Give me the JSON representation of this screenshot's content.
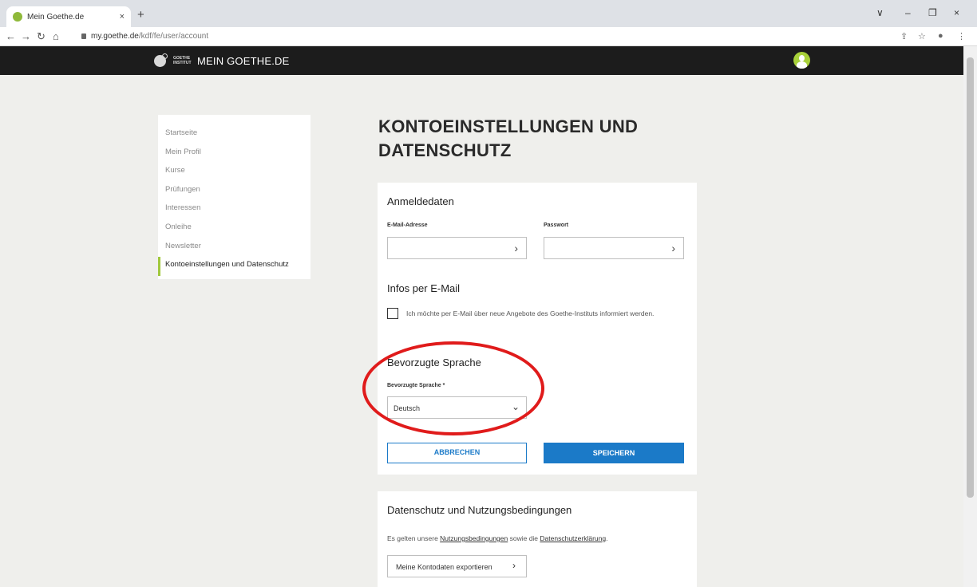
{
  "browser": {
    "tab_title": "Mein Goethe.de",
    "tab_close": "×",
    "new_tab": "+",
    "url_domain": "my.goethe.de",
    "url_path": "/kdf/fe/user/account",
    "window_controls": [
      "∨",
      "–",
      "❐",
      "×"
    ]
  },
  "site": {
    "logo_small": "GOETHE INSTITUT",
    "brand": "MEIN GOETHE.DE"
  },
  "sidebar": {
    "items": [
      {
        "label": "Startseite"
      },
      {
        "label": "Mein Profil"
      },
      {
        "label": "Kurse"
      },
      {
        "label": "Prüfungen"
      },
      {
        "label": "Interessen"
      },
      {
        "label": "Onleihe"
      },
      {
        "label": "Newsletter"
      },
      {
        "label": "Kontoeinstellungen und Datenschutz"
      }
    ],
    "active_index": 7
  },
  "main": {
    "title": "KONTOEINSTELLUNGEN UND DATENSCHUTZ",
    "login": {
      "heading": "Anmeldedaten",
      "email_label": "E-Mail-Adresse",
      "password_label": "Passwort"
    },
    "email_info": {
      "heading": "Infos per E-Mail",
      "checkbox_text": "Ich möchte per E-Mail über neue Angebote des Goethe-Instituts informiert werden."
    },
    "language": {
      "heading": "Bevorzugte Sprache",
      "label": "Bevorzugte Sprache *",
      "selected": "Deutsch"
    },
    "buttons": {
      "cancel": "ABBRECHEN",
      "save": "SPEICHERN"
    },
    "privacy": {
      "heading": "Datenschutz und Nutzungsbedingungen",
      "text_prefix": "Es gelten unsere ",
      "link_terms": "Nutzungsbedingungen",
      "text_middle": " sowie die ",
      "link_privacy": "Datenschutzerklärung",
      "text_suffix": ".",
      "export_button": "Meine Kontodaten exportieren"
    }
  },
  "colors": {
    "accent_blue": "#1b7ac8",
    "active_green": "#a0c83c",
    "annotation_red": "#e01b1b",
    "header_black": "#1c1c1c"
  }
}
